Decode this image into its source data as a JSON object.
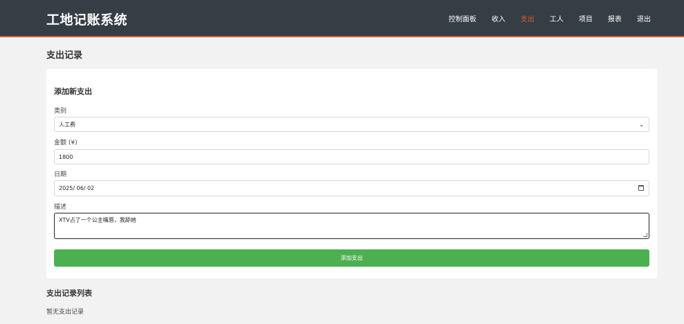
{
  "header": {
    "brand": "工地记账系统",
    "nav": [
      {
        "label": "控制面板"
      },
      {
        "label": "收入"
      },
      {
        "label": "支出"
      },
      {
        "label": "工人"
      },
      {
        "label": "项目"
      },
      {
        "label": "报表"
      },
      {
        "label": "退出"
      }
    ],
    "active_nav": "支出",
    "accent_color": "#e25a2c"
  },
  "page": {
    "title": "支出记录"
  },
  "form": {
    "title": "添加新支出",
    "category": {
      "label": "类别",
      "value": "人工费"
    },
    "amount": {
      "label": "金额 (¥)",
      "value": "1800"
    },
    "date": {
      "label": "日期",
      "value": "2025/ 06/ 02"
    },
    "description": {
      "label": "描述",
      "value": "XTV占了一个公主嘴唇，我舔她"
    },
    "submit_label": "添加支出",
    "submit_color": "#4caf50"
  },
  "list": {
    "title": "支出记录列表",
    "empty_text": "暂无支出记录"
  }
}
